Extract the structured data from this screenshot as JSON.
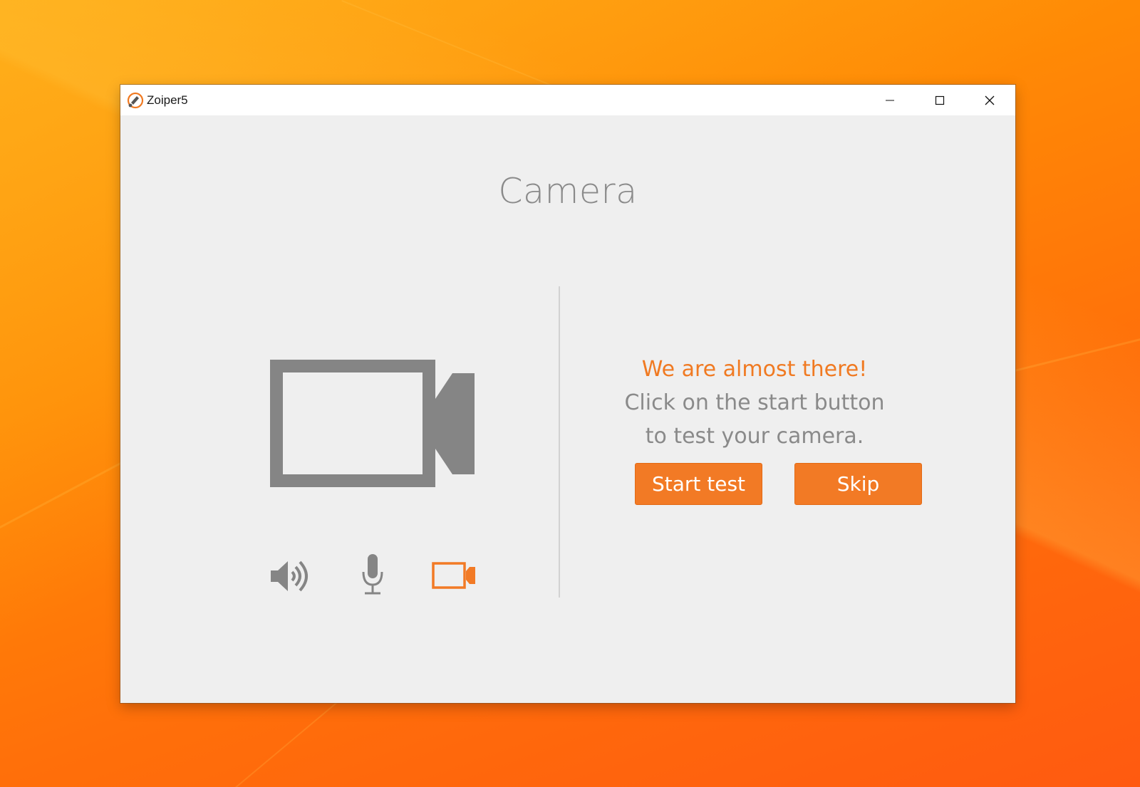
{
  "window": {
    "title": "Zoiper5"
  },
  "page": {
    "title": "Camera"
  },
  "message": {
    "headline": "We are almost there!",
    "line1": "Click on the start button",
    "line2": "to test your camera."
  },
  "buttons": {
    "start_label": "Start test",
    "skip_label": "Skip"
  },
  "steps": [
    {
      "icon": "speaker-icon",
      "active": false
    },
    {
      "icon": "microphone-icon",
      "active": false
    },
    {
      "icon": "camera-icon",
      "active": true
    }
  ],
  "colors": {
    "accent": "#f27a25",
    "icon_gray": "#858585",
    "text_gray": "#8a8a8a",
    "window_bg": "#efefef"
  }
}
